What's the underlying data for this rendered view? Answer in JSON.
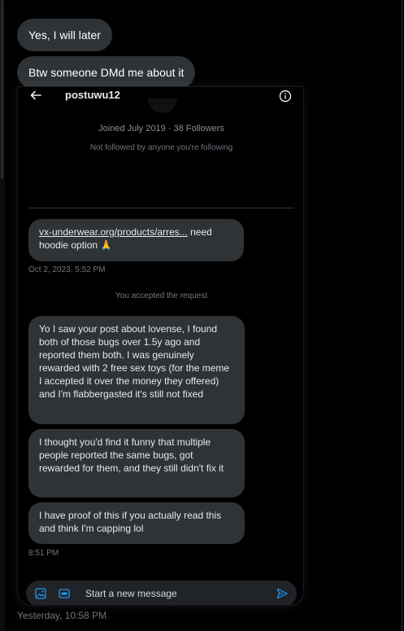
{
  "messages": {
    "m1": "Yes, I will later",
    "m2": "Btw someone DMd me about it"
  },
  "screenshot": {
    "header": {
      "username": "postuwu12"
    },
    "profile": {
      "joined": "Joined July 2019 · 38 Followers",
      "not_followed": "Not followed by anyone you're following"
    },
    "dms": {
      "link_text": "vx-underwear.org/products/arres...",
      "link_suffix": " need hoodie option",
      "emoji": "🙏",
      "time1": "Oct 2, 2023, 5:52 PM",
      "accepted": "You accepted the request",
      "msg2": "Yo I saw your post about lovense, I found both of those bugs over 1.5y ago and reported them both. I was genuinely rewarded with 2 free sex toys (for the meme I accepted it over the money they offered) and I'm flabbergasted it's still not fixed",
      "msg3": "I thought you'd find it funny that multiple people reported the same bugs, got rewarded for them, and they still didn't fix it",
      "msg4": "I have proof of this if you actually read this and think I'm capping lol",
      "time2": "8:51 PM"
    },
    "composer": {
      "placeholder": "Start a new message"
    }
  },
  "footer": {
    "timestamp": "Yesterday, 10:58 PM"
  },
  "colors": {
    "accent": "#1d9bf0",
    "bubble": "#2f3336",
    "background": "#000000"
  },
  "icons": [
    "back-arrow-icon",
    "info-icon",
    "media-icon",
    "gif-icon",
    "send-icon"
  ]
}
